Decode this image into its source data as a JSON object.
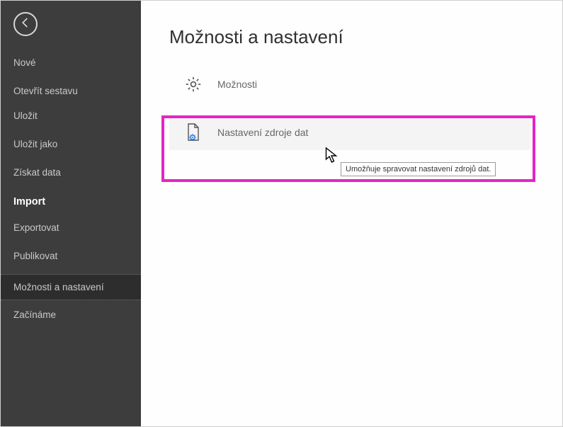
{
  "sidebar": {
    "items": [
      {
        "label": "Nové"
      },
      {
        "label": "Otevřít sestavu"
      },
      {
        "label": "Uložit"
      },
      {
        "label": "Uložit jako"
      },
      {
        "label": "Získat data"
      },
      {
        "label": "Import"
      },
      {
        "label": "Exportovat"
      },
      {
        "label": "Publikovat"
      },
      {
        "label": "Možnosti a nastavení"
      },
      {
        "label": "Začínáme"
      }
    ]
  },
  "main": {
    "title": "Možnosti a nastavení",
    "options": {
      "moznosti": "Možnosti",
      "nastaveni_zdroje": "Nastavení zdroje dat"
    },
    "tooltip": "Umožňuje spravovat nastavení zdrojů dat."
  }
}
